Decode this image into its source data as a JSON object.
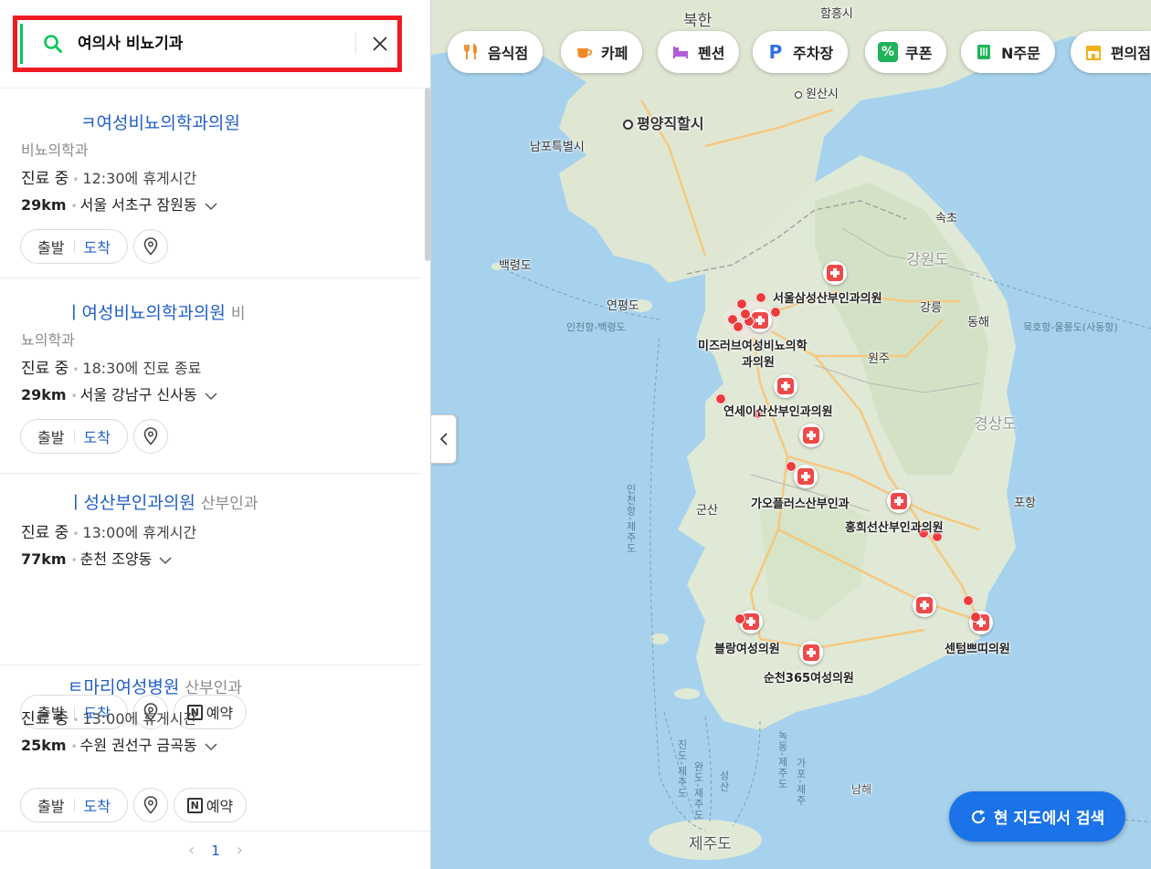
{
  "search": {
    "query": "여의사 비뇨기과"
  },
  "results": [
    {
      "title": "ㅋ여성비뇨의학과의원",
      "category": "비뇨의학과",
      "status": "진료 중",
      "status_sub": "12:30에 휴게시간",
      "distance": "29km",
      "address": "서울 서초구 잠원동",
      "depart": "출발",
      "arrive": "도착"
    },
    {
      "title": "ㅣ여성비뇨의학과의원",
      "category_inline": "비",
      "category": "뇨의학과",
      "status": "진료 중",
      "status_sub": "18:30에 진료 종료",
      "distance": "29km",
      "address": "서울 강남구 신사동",
      "depart": "출발",
      "arrive": "도착"
    },
    {
      "title": "ㅣ성산부인과의원",
      "category_inline": "산부인과",
      "status": "진료 중",
      "status_sub": "13:00에 휴게시간",
      "distance": "77km",
      "address": "춘천 조양동",
      "depart": "출발",
      "arrive": "도착",
      "book": "예약",
      "nbadge": "N"
    },
    {
      "title": "ㅌ마리여성병원",
      "category_inline": "산부인과",
      "status": "진료 중",
      "status_sub": "13:00에 휴게시간",
      "distance": "25km",
      "address": "수원 권선구 금곡동",
      "depart": "출발",
      "arrive": "도착",
      "book": "예약",
      "nbadge": "N"
    }
  ],
  "pagination": {
    "prev": "‹",
    "current": "1",
    "next": "›"
  },
  "chips": [
    {
      "label": "음식점",
      "icon": "fork-knife-icon",
      "color": "#f08a24"
    },
    {
      "label": "카페",
      "icon": "coffee-cup-icon",
      "color": "#f08a24"
    },
    {
      "label": "펜션",
      "icon": "bed-icon",
      "color": "#b05cd6"
    },
    {
      "label": "주차장",
      "icon": "parking-icon",
      "glyph": "P",
      "color": "#2f6fe4"
    },
    {
      "label": "쿠폰",
      "icon": "coupon-icon",
      "glyph": "%",
      "color": "#1fb45a"
    },
    {
      "label": "N주문",
      "icon": "order-icon",
      "color": "#1fb45a"
    },
    {
      "label": "편의점",
      "icon": "store-icon",
      "color": "#f2b019"
    }
  ],
  "research_button": "현 지도에서 검색",
  "map": {
    "labels": {
      "north_korea": "북한",
      "hamheung": "함흥시",
      "wonsan": "원산시",
      "pyongyang": "평양직할시",
      "nampo": "남포특별시",
      "sokcho": "속초",
      "gangwon": "강원도",
      "baengnyeong": "백령도",
      "yeonpyeong": "연평도",
      "incheon_baengnyeong": "인천항-백령도",
      "gangneung": "강릉",
      "donghae": "동해",
      "mukho": "묵호항-울릉도(사동항)",
      "wonju": "원주",
      "gyeongsang": "경상도",
      "gunsan": "군산",
      "pohang": "포항",
      "incheon_jeju": "인천항-제주도",
      "namhae": "남해",
      "jeju": "제주도",
      "jindo_jeju": "진도-제주도",
      "wando_jeju": "완도-제주도",
      "nokdong_jeju": "녹동-제주도",
      "seongsan": "성산",
      "gapo_jeju": "가포-제주"
    },
    "hospitals": {
      "h1": "서울삼성산부인과의원",
      "h2a": "미즈러브여성비뇨의학",
      "h2b": "과의원",
      "h3": "연세이산산부인과의원",
      "h4": "가오플러스산부인과",
      "h5": "홍희선산부인과의원",
      "h6": "블랑여성의원",
      "h7": "순천365여성의원",
      "h8": "센텀쁘띠의원"
    }
  }
}
